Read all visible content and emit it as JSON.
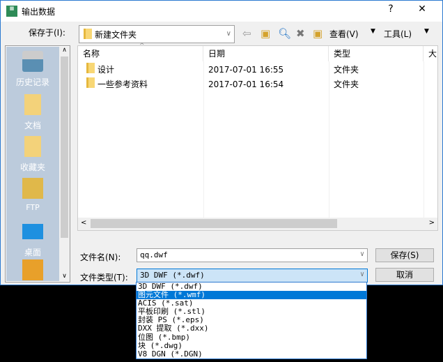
{
  "window": {
    "title": "输出数据",
    "help": "?",
    "close": "✕"
  },
  "toolbar": {
    "save_in_label": "保存于(I):",
    "location": "新建文件夹",
    "view_label": "查看(V)",
    "tools_label": "工具(L)"
  },
  "sidebar": {
    "items": [
      {
        "label": "历史记录"
      },
      {
        "label": "文档"
      },
      {
        "label": "收藏夹"
      },
      {
        "label": "FTP"
      },
      {
        "label": "桌面"
      }
    ]
  },
  "list": {
    "columns": [
      "名称",
      "日期",
      "类型",
      "大"
    ],
    "rows": [
      {
        "name": "设计",
        "date": "2017-07-01 16:55",
        "type": "文件夹"
      },
      {
        "name": "一些参考资料",
        "date": "2017-07-01 16:54",
        "type": "文件夹"
      }
    ]
  },
  "form": {
    "filename_label": "文件名(N):",
    "filename_value": "qq.dwf",
    "filetype_label": "文件类型(T):",
    "filetype_value": "3D DWF (*.dwf)",
    "save_button": "保存(S)",
    "cancel_button": "取消"
  },
  "dropdown": {
    "options": [
      "3D DWF (*.dwf)",
      "图元文件 (*.wmf)",
      "ACIS (*.sat)",
      "平板印刷 (*.stl)",
      "封装 PS (*.eps)",
      "DXX 提取 (*.dxx)",
      "位图 (*.bmp)",
      "块 (*.dwg)",
      "V8 DGN (*.DGN)"
    ],
    "selected_index": 1
  }
}
